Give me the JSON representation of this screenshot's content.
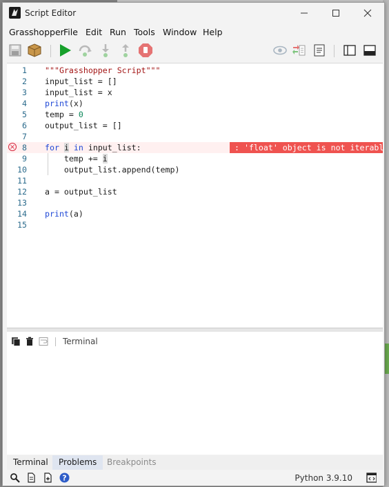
{
  "window": {
    "title": "Script Editor"
  },
  "menu": [
    "Grasshopper",
    "File",
    "Edit",
    "Run",
    "Tools",
    "Window",
    "Help"
  ],
  "toolbar": {
    "icons": [
      "save-icon",
      "package-icon",
      "run-icon",
      "step-over-icon",
      "step-into-icon",
      "step-out-icon",
      "stop-icon",
      "watch-eye-icon",
      "compare-icon",
      "notes-icon",
      "layout-vertical-icon",
      "layout-horizontal-icon"
    ]
  },
  "editor": {
    "line_numbers": [
      "1",
      "2",
      "3",
      "4",
      "5",
      "6",
      "7",
      "8",
      "9",
      "10",
      "11",
      "12",
      "13",
      "14",
      "15"
    ],
    "lines": [
      {
        "parts": [
          {
            "t": "\"\"\"Grasshopper Script\"\"\"",
            "c": "str"
          }
        ]
      },
      {
        "parts": [
          {
            "t": "input_list = []",
            "c": ""
          }
        ]
      },
      {
        "parts": [
          {
            "t": "input_list = x",
            "c": ""
          }
        ]
      },
      {
        "parts": [
          {
            "t": "print",
            "c": "kw"
          },
          {
            "t": "(x)",
            "c": ""
          }
        ]
      },
      {
        "parts": [
          {
            "t": "temp = ",
            "c": ""
          },
          {
            "t": "0",
            "c": "num"
          }
        ]
      },
      {
        "parts": [
          {
            "t": "output_list = []",
            "c": ""
          }
        ]
      },
      {
        "parts": []
      },
      {
        "parts": [
          {
            "t": "for",
            "c": "kw"
          },
          {
            "t": " ",
            "c": ""
          },
          {
            "t": "i",
            "c": "hl"
          },
          {
            "t": " ",
            "c": ""
          },
          {
            "t": "in",
            "c": "kw"
          },
          {
            "t": " input_list:",
            "c": ""
          }
        ]
      },
      {
        "parts": [
          {
            "t": "    temp += ",
            "c": ""
          },
          {
            "t": "i",
            "c": "hl"
          }
        ]
      },
      {
        "parts": [
          {
            "t": "    output_list.append(temp)",
            "c": ""
          }
        ]
      },
      {
        "parts": []
      },
      {
        "parts": [
          {
            "t": "a = output_list",
            "c": ""
          }
        ]
      },
      {
        "parts": []
      },
      {
        "parts": [
          {
            "t": "print",
            "c": "kw"
          },
          {
            "t": "(a)",
            "c": ""
          }
        ]
      },
      {
        "parts": []
      }
    ],
    "error_line": 8,
    "error_message": ": 'float' object is not iterable"
  },
  "panel": {
    "title": "Terminal"
  },
  "tabs": [
    {
      "label": "Terminal",
      "state": "normal"
    },
    {
      "label": "Problems",
      "state": "active"
    },
    {
      "label": "Breakpoints",
      "state": "dim"
    }
  ],
  "status": {
    "python_version": "Python 3.9.10"
  },
  "colors": {
    "error": "#ef5350",
    "keyword": "#1f48d6",
    "string": "#a31515",
    "number": "#098658",
    "line_number": "#2b6b8c"
  }
}
